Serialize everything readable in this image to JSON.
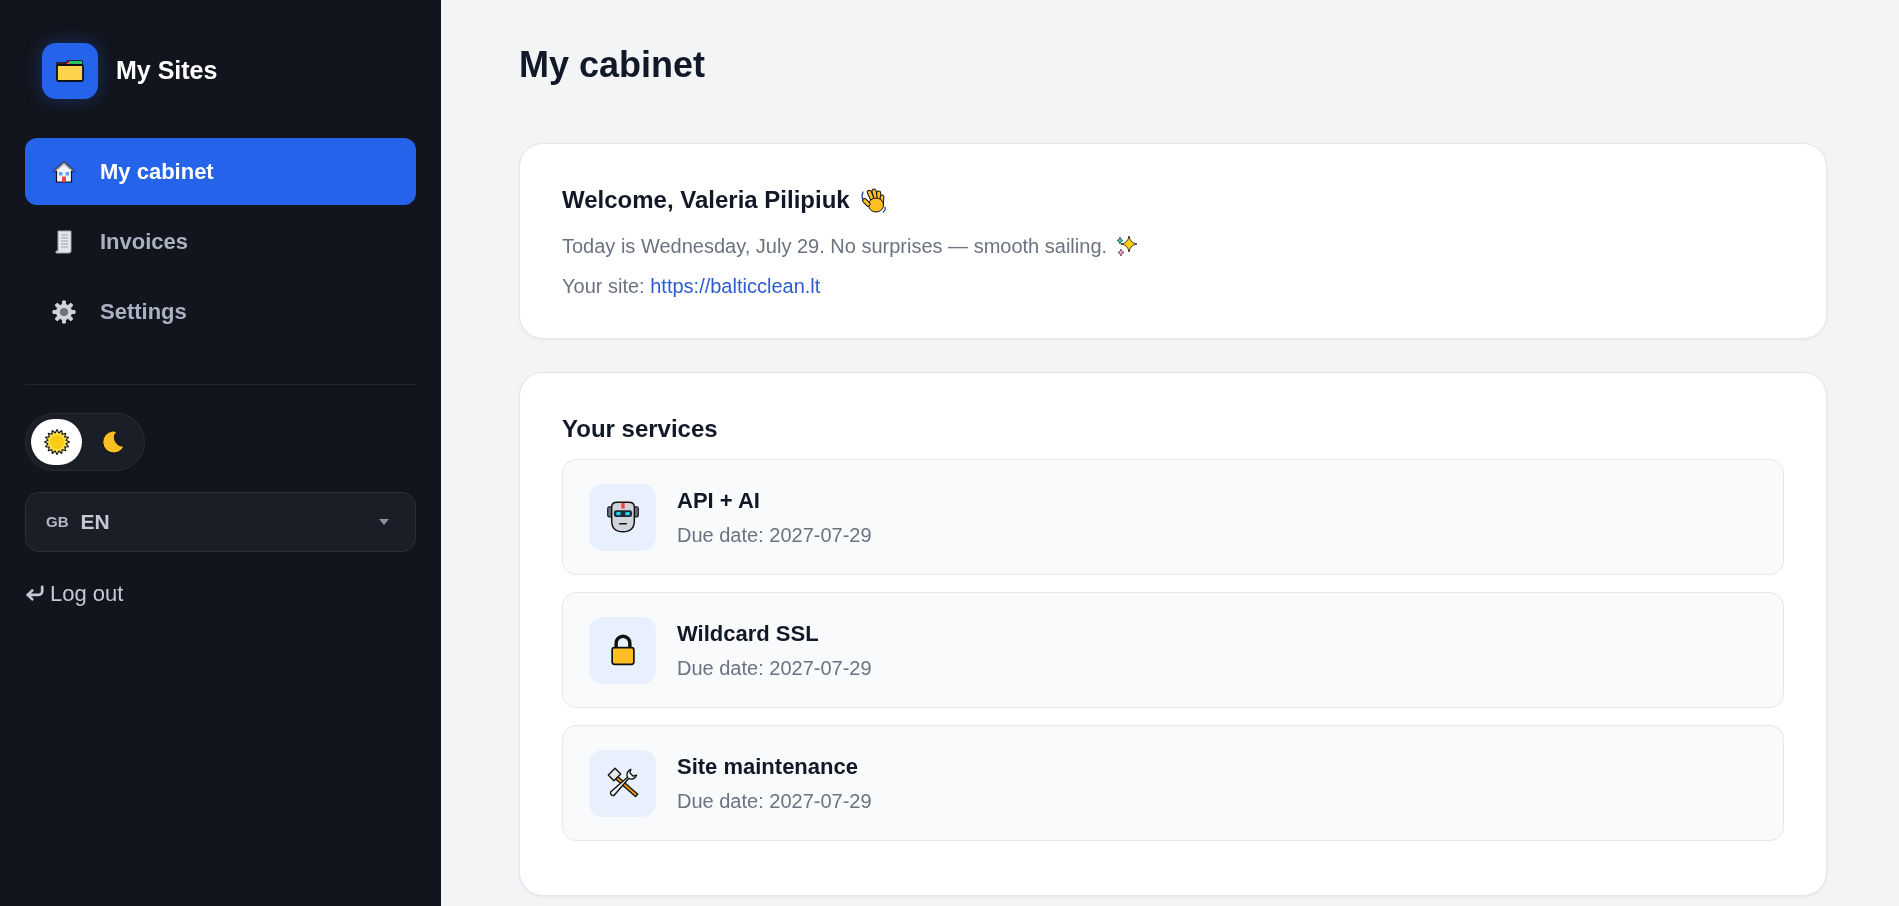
{
  "sidebar": {
    "brand": {
      "title": "My Sites"
    },
    "nav": [
      {
        "label": "My cabinet",
        "selected": true
      },
      {
        "label": "Invoices",
        "selected": false
      },
      {
        "label": "Settings",
        "selected": false
      }
    ],
    "theme_toggle": {
      "options": [
        {
          "selected": true
        },
        {
          "selected": false
        }
      ]
    },
    "language_select": {
      "flag": "GB",
      "value": "EN"
    },
    "logout": {
      "label": "Log out"
    }
  },
  "main": {
    "title": "My cabinet",
    "welcome": {
      "greeting": "Welcome, Valeria Pilipiuk",
      "date_line": "Today is Wednesday, July 29. No surprises — smooth sailing.",
      "site_label": "Your site:",
      "site_url": "https://balticclean.lt"
    },
    "services": {
      "title": "Your services",
      "items": [
        {
          "name": "API + AI",
          "due": "Due date: 2027-07-29"
        },
        {
          "name": "Wildcard SSL",
          "due": "Due date: 2027-07-29"
        },
        {
          "name": "Site maintenance",
          "due": "Due date: 2027-07-29"
        }
      ]
    }
  }
}
